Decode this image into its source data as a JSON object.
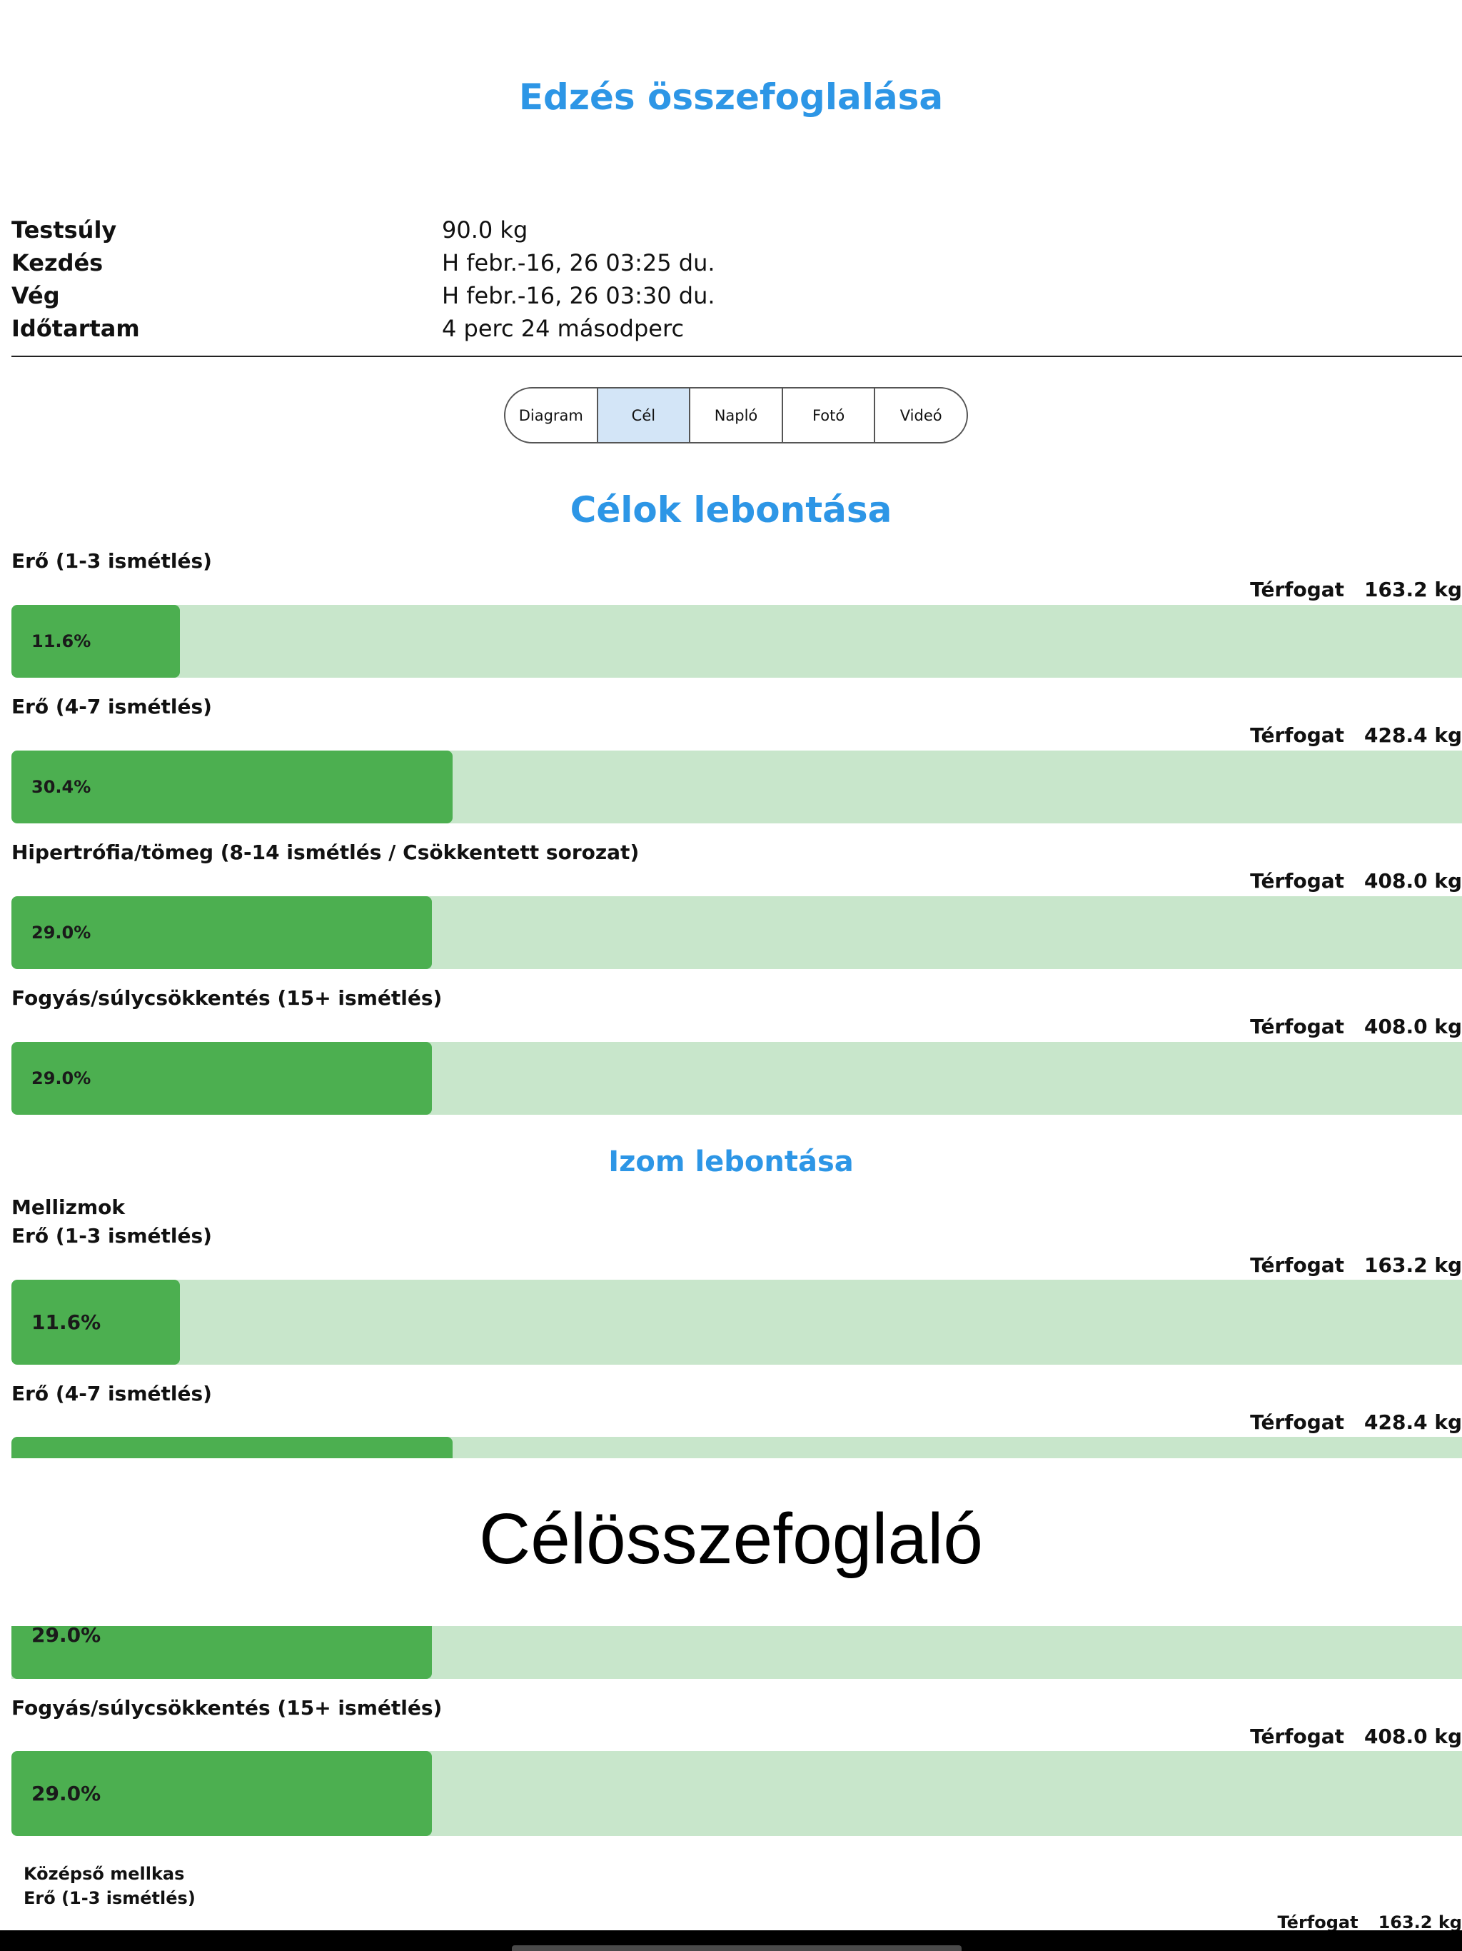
{
  "header": {
    "title": "Edzés összefoglalása"
  },
  "info": [
    {
      "label": "Testsúly",
      "value": "90.0 kg"
    },
    {
      "label": "Kezdés",
      "value": "H febr.-16, 26 03:25 du."
    },
    {
      "label": "Vég",
      "value": "H febr.-16, 26 03:30 du."
    },
    {
      "label": "Időtartam",
      "value": "4 perc 24 másodperc"
    }
  ],
  "segments": [
    {
      "label": "Diagram",
      "active": false
    },
    {
      "label": "Cél",
      "active": true
    },
    {
      "label": "Napló",
      "active": false
    },
    {
      "label": "Fotó",
      "active": false
    },
    {
      "label": "Videó",
      "active": false
    }
  ],
  "goals": {
    "title": "Célok lebontása",
    "items": [
      {
        "label": "Erő (1-3 ismétlés)",
        "volume_label": "Térfogat",
        "volume": "163.2 kg",
        "percent_text": "11.6%",
        "percent": 11.6
      },
      {
        "label": "Erő (4-7 ismétlés)",
        "volume_label": "Térfogat",
        "volume": "428.4 kg",
        "percent_text": "30.4%",
        "percent": 30.4
      },
      {
        "label": "Hipertrófia/tömeg (8-14 ismétlés / Csökkentett sorozat)",
        "volume_label": "Térfogat",
        "volume": "408.0 kg",
        "percent_text": "29.0%",
        "percent": 29.0
      },
      {
        "label": "Fogyás/súlycsökkentés (15+ ismétlés)",
        "volume_label": "Térfogat",
        "volume": "408.0 kg",
        "percent_text": "29.0%",
        "percent": 29.0
      }
    ]
  },
  "muscles": {
    "title": "Izom lebontása",
    "group1": {
      "name": "Mellizmok",
      "items": [
        {
          "label": "Erő (1-3 ismétlés)",
          "volume_label": "Térfogat",
          "volume": "163.2 kg",
          "percent_text": "11.6%",
          "percent": 11.6
        },
        {
          "label": "Erő (4-7 ismétlés)",
          "volume_label": "Térfogat",
          "volume": "428.4 kg",
          "percent": 30.4
        }
      ]
    },
    "partial": {
      "percent_text": "29.0%",
      "percent": 29.0
    },
    "item_weightloss": {
      "label": "Fogyás/súlycsökkentés (15+ ismétlés)",
      "volume_label": "Térfogat",
      "volume": "408.0 kg",
      "percent_text": "29.0%",
      "percent": 29.0
    },
    "group2": {
      "name": "Középső mellkas",
      "item_label": "Erő (1-3 ismétlés)",
      "volume_label": "Térfogat",
      "volume": "163.2 kg"
    }
  },
  "overlay": {
    "caption": "Célösszefoglaló"
  },
  "colors": {
    "accent": "#2d96e6",
    "bar_fill": "#4caf50",
    "bar_track": "#c8e6cb",
    "segment_active": "#d3e5f7"
  }
}
